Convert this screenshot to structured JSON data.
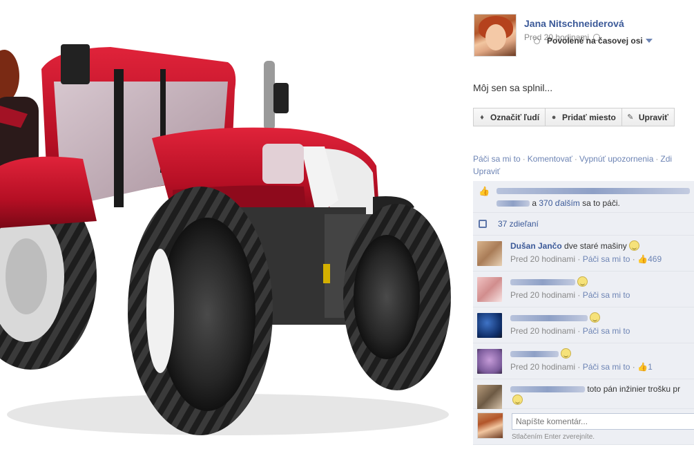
{
  "post": {
    "author_name": "Jana Nitschneiderová",
    "time": "Pred 20 hodinami",
    "timeline_visibility": "Povolené na časovej osi",
    "caption": "Môj sen sa splnil..."
  },
  "toolbar": {
    "tag_label": "Označiť ľudí",
    "place_label": "Pridať miesto",
    "edit_label": "Upraviť"
  },
  "actions": {
    "like": "Páči sa mi to",
    "comment": "Komentovať",
    "notifications": "Vypnúť upozornenia",
    "cut_off": "Zdi",
    "edit": "Upraviť"
  },
  "likes": {
    "connector": "a",
    "others_link": "370 ďalším",
    "suffix": "sa to páči."
  },
  "shares": {
    "label": "37 zdieľaní"
  },
  "comments": [
    {
      "name": "Dušan Jančo",
      "text": "dve staré mašiny",
      "time": "Pred 20 hodinami",
      "like": "Páči sa mi to",
      "like_count": "469"
    },
    {
      "name": "",
      "text": "",
      "time": "Pred 20 hodinami",
      "like": "Páči sa mi to",
      "like_count": ""
    },
    {
      "name": "",
      "text": "",
      "time": "Pred 20 hodinami",
      "like": "Páči sa mi to",
      "like_count": ""
    },
    {
      "name": "",
      "text": "",
      "time": "Pred 20 hodinami",
      "like": "Páči sa mi to",
      "like_count": "1"
    },
    {
      "name": "",
      "text": "toto pán inžinier trošku pr",
      "time": "",
      "like": "",
      "like_count": ""
    }
  ],
  "compose": {
    "placeholder": "Napíšte komentár...",
    "hint": "Stlačením Enter zverejníte."
  },
  "colors": {
    "link": "#3b5998",
    "feed_bg": "#edeff4",
    "tractor_red": "#c8102e"
  }
}
